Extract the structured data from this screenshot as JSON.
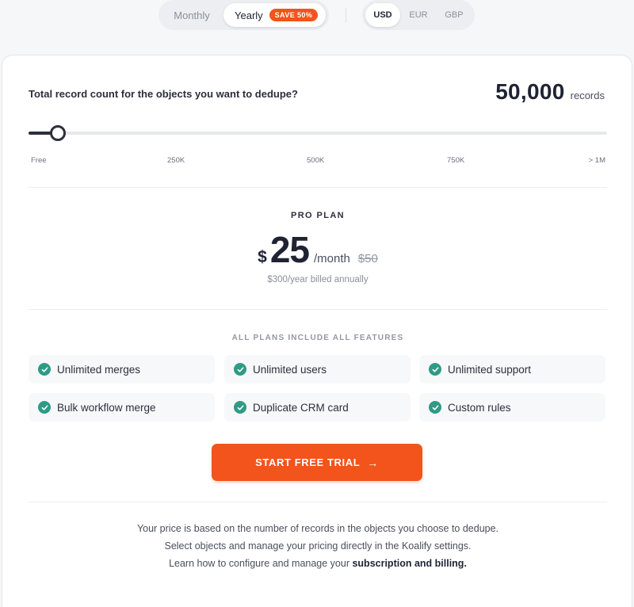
{
  "billing": {
    "monthly_label": "Monthly",
    "yearly_label": "Yearly",
    "save_badge": "SAVE 50%",
    "selected": "Yearly"
  },
  "currency": {
    "options": [
      "USD",
      "EUR",
      "GBP"
    ],
    "selected": "USD"
  },
  "records": {
    "question": "Total record count for the objects you want to dedupe?",
    "count": "50,000",
    "unit": "records",
    "slider_fraction": 0.05,
    "ticks": [
      "Free",
      "250K",
      "500K",
      "750K",
      "> 1M"
    ]
  },
  "plan": {
    "name": "PRO PLAN",
    "currency_symbol": "$",
    "price": "25",
    "period": "/month",
    "old_price": "$50",
    "billed_note": "$300/year billed annually"
  },
  "features": {
    "heading": "ALL PLANS INCLUDE ALL FEATURES",
    "items": [
      "Unlimited merges",
      "Unlimited users",
      "Unlimited support",
      "Bulk workflow merge",
      "Duplicate CRM card",
      "Custom rules"
    ]
  },
  "cta": {
    "label": "START FREE TRIAL",
    "arrow": "→"
  },
  "footer": {
    "line1": "Your price is based on the number of records in the objects you choose to dedupe.",
    "line2": "Select objects and manage your pricing directly in the Koalify settings.",
    "line3_prefix": "Learn how to configure and manage your ",
    "line3_link": "subscription and billing."
  },
  "colors": {
    "accent": "#f2541b",
    "check": "#2f9a85",
    "dark": "#1f2333"
  }
}
